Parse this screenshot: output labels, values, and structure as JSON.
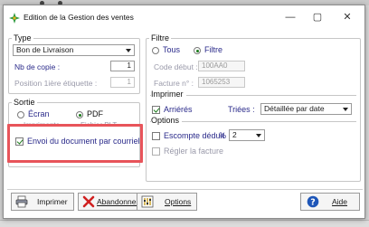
{
  "window": {
    "title": "Edition de la Gestion des ventes",
    "minimize_glyph": "—",
    "maximize_glyph": "▢",
    "close_glyph": "✕"
  },
  "type_group": {
    "label": "Type",
    "document_type": "Bon de Livraison",
    "copies_label": "Nb de copie :",
    "copies_value": "1",
    "position_label": "Position 1ière étiquette :",
    "position_value": "1"
  },
  "sortie_group": {
    "label": "Sortie",
    "ecran_label": "Écran",
    "pdf_label": "PDF",
    "imprimante_label": "Imprimante",
    "fichier_label": "Fichier PLT",
    "email_label": "Envoi du document par courriel",
    "selected_output": "PDF",
    "email_checked": true
  },
  "filtre_group": {
    "label": "Filtre",
    "tous_label": "Tous",
    "filtre_label": "Filtre",
    "selected": "Filtre",
    "code_debut_label": "Code début :",
    "code_debut_value": "100AA0",
    "facture_label": "Facture n° :",
    "facture_value": "1065253"
  },
  "imprimer_section": {
    "label": "Imprimer",
    "arrieres_label": "Arriérés",
    "arrieres_checked": true,
    "triees_label": "Triées :",
    "triees_value": "Détaillée par date"
  },
  "options_section": {
    "label": "Options",
    "escompte_label": "Escompte déduit",
    "percent_label": "%",
    "percent_value": "2",
    "regler_label": "Régler la facture"
  },
  "buttons": {
    "imprimer": "Imprimer",
    "abandonner": "Abandonner",
    "options": "Options",
    "aide": "Aide"
  },
  "colors": {
    "highlight": "#e8545a",
    "check_green": "#1a7a1a",
    "label_blue": "#2a2a8a"
  },
  "icons": [
    "app-icon",
    "printer-icon",
    "cancel-x-icon",
    "options-icon",
    "help-icon"
  ]
}
